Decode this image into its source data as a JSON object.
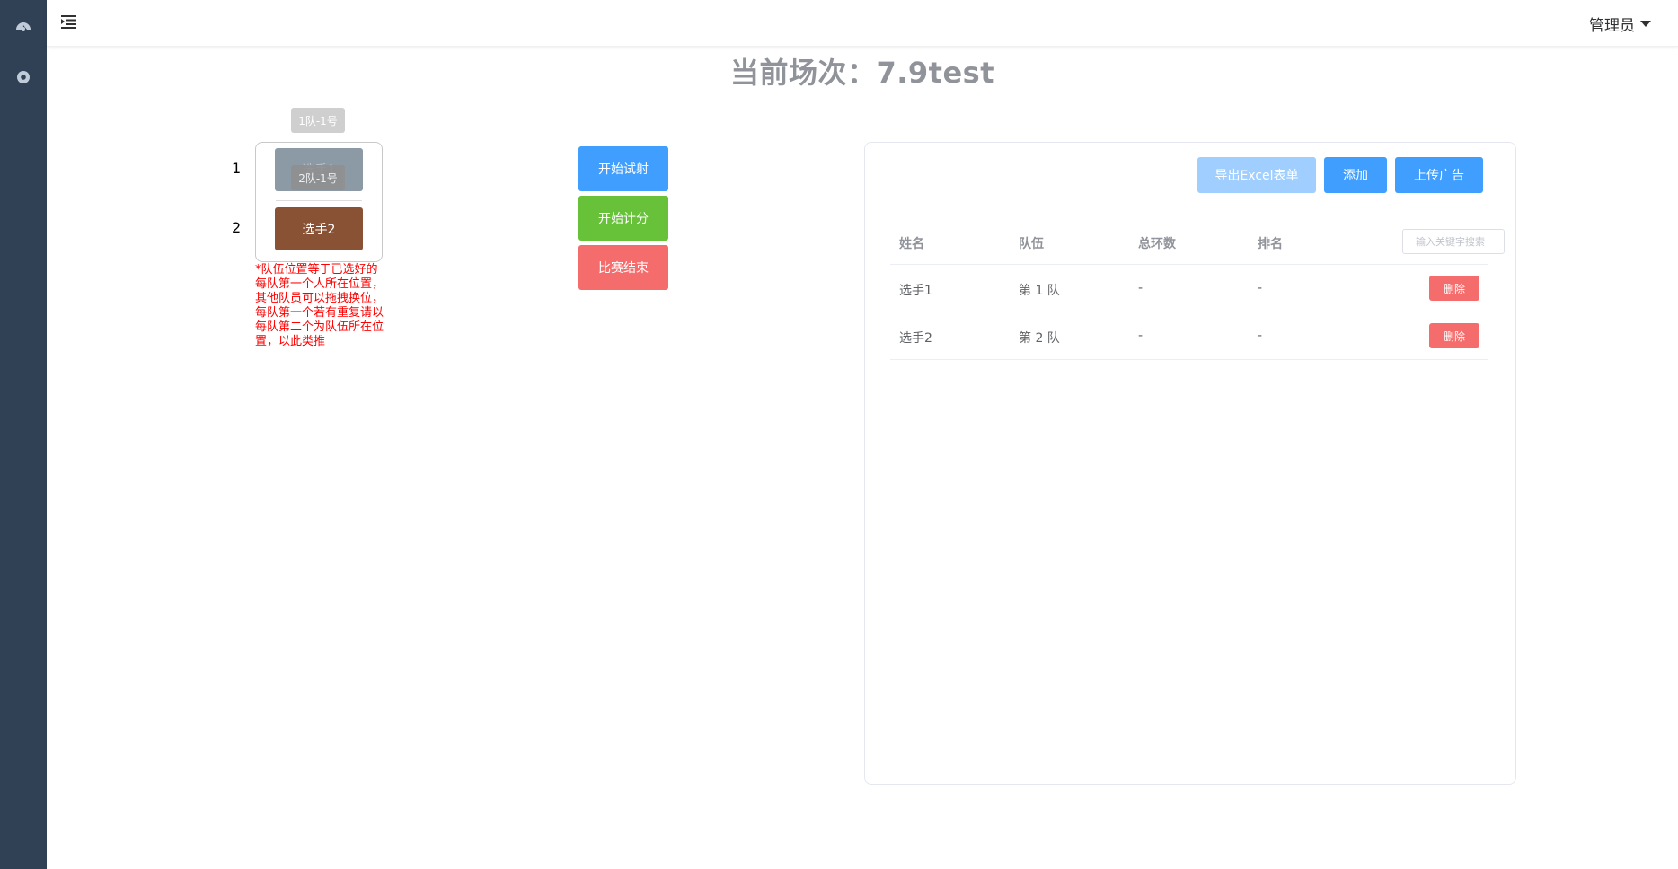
{
  "header": {
    "user_label": "管理员"
  },
  "title": "当前场次：7.9test",
  "lanes": {
    "numbers": [
      "1",
      "2"
    ],
    "cards": [
      "选手1",
      "选手2"
    ],
    "tooltips": [
      "1队-1号",
      "2队-1号"
    ],
    "note": "*队伍位置等于已选好的每队第一个人所在位置，其他队员可以拖拽换位，每队第一个若有重复请以每队第二个为队伍所在位置，以此类推"
  },
  "controls": {
    "start_trial": "开始试射",
    "start_scoring": "开始计分",
    "end_match": "比赛结束"
  },
  "panel": {
    "export_label": "导出Excel表单",
    "add_label": "添加",
    "upload_label": "上传广告",
    "search_placeholder": "输入关键字搜索",
    "columns": [
      "姓名",
      "队伍",
      "总环数",
      "排名"
    ],
    "rows": [
      {
        "name": "选手1",
        "team": "第 1 队",
        "total": "-",
        "rank": "-",
        "action": "删除"
      },
      {
        "name": "选手2",
        "team": "第 2 队",
        "total": "-",
        "rank": "-",
        "action": "删除"
      }
    ]
  },
  "icons": {
    "sidebar": [
      "dashboard-icon",
      "settings-icon"
    ],
    "header": "menu-fold-icon"
  },
  "colors": {
    "sidebar": "#304156",
    "primary": "#409eff",
    "success": "#67c23a",
    "danger": "#f56c6c",
    "note": "#ff0000"
  }
}
